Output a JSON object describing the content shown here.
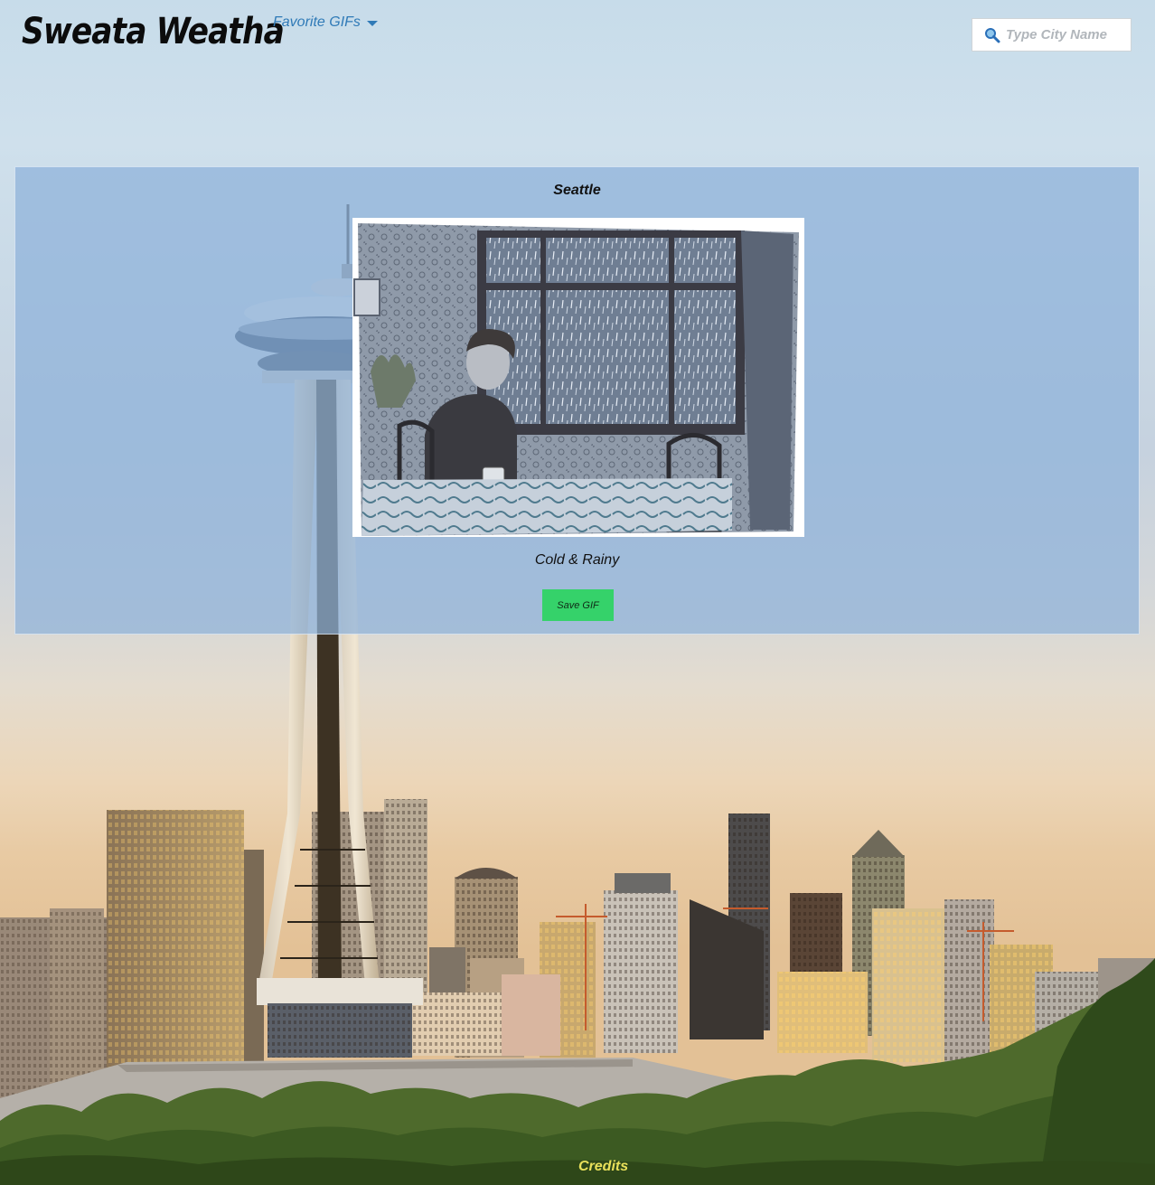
{
  "app": {
    "title": "Sweata Weatha"
  },
  "nav": {
    "favorites_label": "Favorite GIFs"
  },
  "search": {
    "placeholder": "Type City Name",
    "value": ""
  },
  "weather": {
    "city": "Seattle",
    "condition": "Cold & Rainy",
    "save_label": "Save GIF"
  },
  "footer": {
    "credits_label": "Credits"
  },
  "colors": {
    "nav_link": "#2f7ab7",
    "save_button": "#35d26a",
    "credits": "#e8e05a",
    "card_overlay": "#8eb1da"
  },
  "icons": {
    "search": "magnifier-icon",
    "dropdown": "caret-down-icon"
  }
}
